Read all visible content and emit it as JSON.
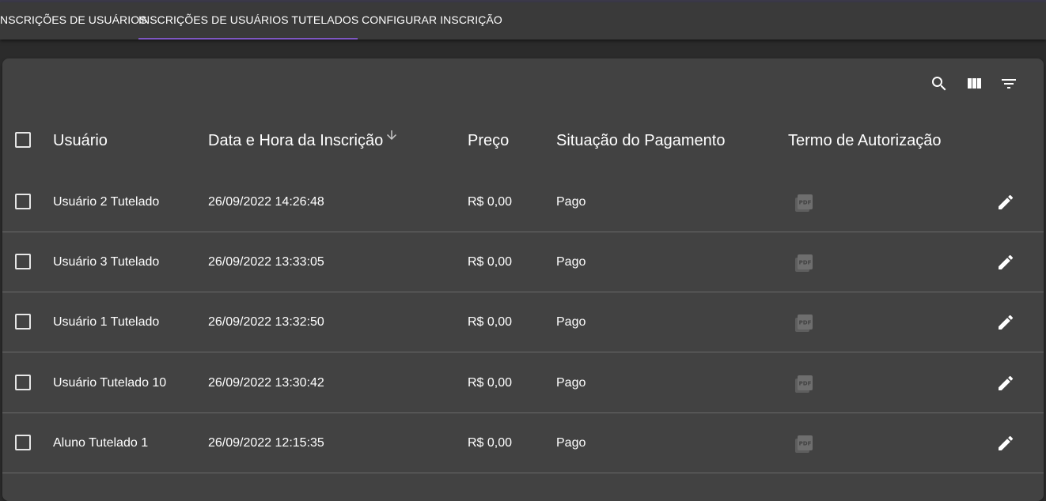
{
  "tabs": [
    {
      "label": "INSCRIÇÕES DE USUÁRIOS"
    },
    {
      "label": "INSCRIÇÕES DE USUÁRIOS TUTELADOS",
      "active": true
    },
    {
      "label": "CONFIGURAR INSCRIÇÃO"
    }
  ],
  "toolbar": {
    "icons": [
      "search-icon",
      "view-column-icon",
      "filter-list-icon"
    ]
  },
  "table": {
    "columns": [
      "Usuário",
      "Data e Hora da Inscrição",
      "Preço",
      "Situação do Pagamento",
      "Termo de Autorização"
    ],
    "sorted_column": "Data e Hora da Inscrição",
    "sort_direction": "descending",
    "rows": [
      {
        "user": "Usuário 2 Tutelado",
        "datetime": "26/09/2022 14:26:48",
        "price": "R$ 0,00",
        "status": "Pago",
        "term_icon": "pdf-icon",
        "action_icon": "edit-icon"
      },
      {
        "user": "Usuário 3 Tutelado",
        "datetime": "26/09/2022 13:33:05",
        "price": "R$ 0,00",
        "status": "Pago",
        "term_icon": "pdf-icon",
        "action_icon": "edit-icon"
      },
      {
        "user": "Usuário 1 Tutelado",
        "datetime": "26/09/2022 13:32:50",
        "price": "R$ 0,00",
        "status": "Pago",
        "term_icon": "pdf-icon",
        "action_icon": "edit-icon"
      },
      {
        "user": "Usuário Tutelado 10",
        "datetime": "26/09/2022 13:30:42",
        "price": "R$ 0,00",
        "status": "Pago",
        "term_icon": "pdf-icon",
        "action_icon": "edit-icon"
      },
      {
        "user": "Aluno Tutelado 1",
        "datetime": "26/09/2022 12:15:35",
        "price": "R$ 0,00",
        "status": "Pago",
        "term_icon": "pdf-icon",
        "action_icon": "edit-icon"
      }
    ]
  },
  "colors": {
    "background": "#2b2b2b",
    "tabbar": "#3a3a3a",
    "paper": "#424242",
    "accent": "#7e57c2",
    "pdf_icon": "#6e6e6e"
  }
}
